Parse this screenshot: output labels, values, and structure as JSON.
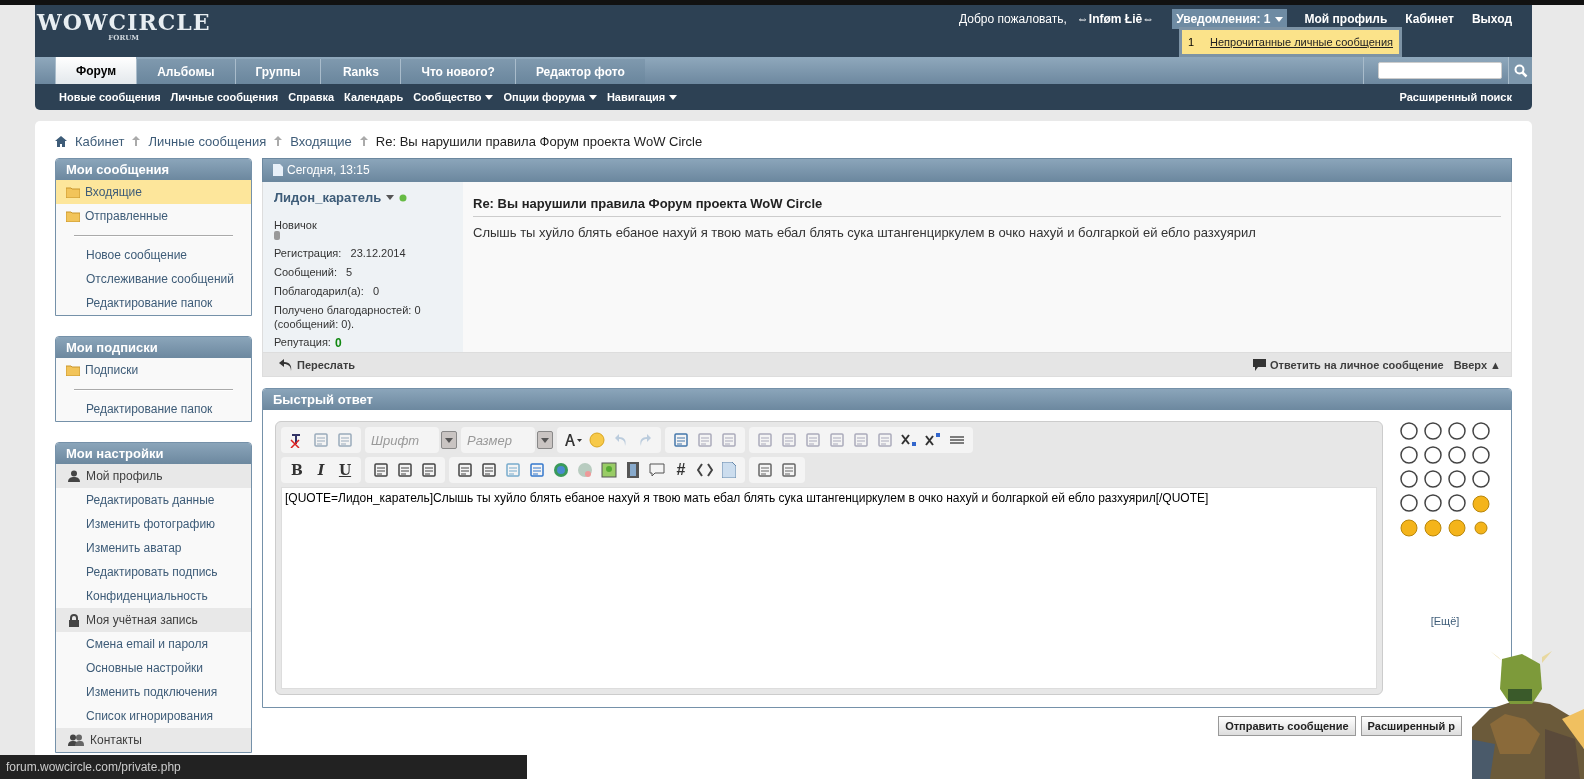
{
  "header": {
    "logo": "WOWCIRCLE",
    "logo_sub": "FORUM",
    "welcome": "Добро пожаловать,",
    "username": "⇔Inføm Łiĕ⇔",
    "notifications": {
      "label": "Уведомления: 1",
      "expanded": true,
      "items": [
        {
          "count": "1",
          "label": "Непрочитанные личные сообщения"
        }
      ]
    },
    "links": [
      "Мой профиль",
      "Кабинет",
      "Выход"
    ]
  },
  "tabs": [
    {
      "label": "Форум",
      "selected": true
    },
    {
      "label": "Альбомы",
      "selected": false
    },
    {
      "label": "Группы",
      "selected": false
    },
    {
      "label": "Ranks",
      "selected": false
    },
    {
      "label": "Что нового?",
      "selected": false
    },
    {
      "label": "Редактор фото",
      "selected": false
    }
  ],
  "subnav": [
    {
      "label": "Новые сообщения",
      "dropdown": false
    },
    {
      "label": "Личные сообщения",
      "dropdown": false
    },
    {
      "label": "Справка",
      "dropdown": false
    },
    {
      "label": "Календарь",
      "dropdown": false
    },
    {
      "label": "Сообщество",
      "dropdown": true
    },
    {
      "label": "Опции форума",
      "dropdown": true
    },
    {
      "label": "Навигация",
      "dropdown": true
    }
  ],
  "advanced_search": "Расширенный поиск",
  "breadcrumb": [
    "Кабинет",
    "Личные сообщения",
    "Входящие",
    "Re: Вы нарушили правила Форум проекта WoW Circle"
  ],
  "sidebar": [
    {
      "title": "Мои сообщения",
      "items": [
        {
          "kind": "folder",
          "label": "Входящие",
          "selected": true
        },
        {
          "kind": "folder",
          "label": "Отправленные",
          "selected": false
        },
        {
          "kind": "divider"
        },
        {
          "kind": "link",
          "label": "Новое сообщение",
          "selected": false
        },
        {
          "kind": "link",
          "label": "Отслеживание сообщений",
          "selected": false
        },
        {
          "kind": "link",
          "label": "Редактирование папок",
          "selected": false
        }
      ]
    },
    {
      "title": "Мои подписки",
      "items": [
        {
          "kind": "folder",
          "label": "Подписки",
          "selected": false
        },
        {
          "kind": "divider"
        },
        {
          "kind": "link",
          "label": "Редактирование папок",
          "selected": false
        }
      ]
    },
    {
      "title": "Мои настройки",
      "items": [
        {
          "kind": "section",
          "label": "Мой профиль"
        },
        {
          "kind": "link",
          "label": "Редактировать данные",
          "selected": false
        },
        {
          "kind": "link",
          "label": "Изменить фотографию",
          "selected": false
        },
        {
          "kind": "link",
          "label": "Изменить аватар",
          "selected": false
        },
        {
          "kind": "link",
          "label": "Редактировать подпись",
          "selected": false
        },
        {
          "kind": "link",
          "label": "Конфиденциальность",
          "selected": false
        },
        {
          "kind": "section",
          "label": "Моя учётная запись"
        },
        {
          "kind": "link",
          "label": "Смена email и пароля",
          "selected": false
        },
        {
          "kind": "link",
          "label": "Основные настройки",
          "selected": false
        },
        {
          "kind": "link",
          "label": "Изменить подключения",
          "selected": false
        },
        {
          "kind": "link",
          "label": "Список игнорирования",
          "selected": false
        },
        {
          "kind": "section",
          "label": "Контакты"
        }
      ]
    }
  ],
  "message": {
    "date": "Сегодня, 13:15",
    "author": {
      "name": "Лидон_каратель",
      "online": true,
      "rank": "Новичок",
      "stats": [
        {
          "label": "Регистрация:",
          "value": "23.12.2014"
        },
        {
          "label": "Сообщений:",
          "value": "5"
        },
        {
          "label": "Поблагодарил(а):",
          "value": "0"
        },
        {
          "label": "Получено благодарностей: 0 (сообщений: 0)."
        }
      ],
      "reputation_label": "Репутация:",
      "reputation": "0"
    },
    "title": "Re: Вы нарушили правила Форум проекта WoW Circle",
    "body": "Слышь ты хуйло блять ебаное нахуй я твою мать ебал блять сука штангенциркулем в очко нахуй и болгаркой ей ебло разхуярил",
    "forward": "Переслать",
    "reply": "Ответить на личное сообщение",
    "top": "Вверх ▲"
  },
  "quick_reply": {
    "title": "Быстрый ответ",
    "font_placeholder": "Шрифт",
    "size_placeholder": "Размер",
    "format_buttons": [
      "B",
      "I",
      "U"
    ],
    "hash_button": "#",
    "text": "[QUOTE=Лидон_каратель]Слышь ты хуйло блять ебаное нахуй я твою мать ебал блять сука штангенциркулем в очко нахуй и болгаркой ей ебло разхуярил[/QUOTE]",
    "more_smilies": "[Ещё]",
    "buttons": [
      "Отправить сообщение",
      "Расширенный р"
    ]
  },
  "status_bar": "forum.wowcircle.com/private.php"
}
